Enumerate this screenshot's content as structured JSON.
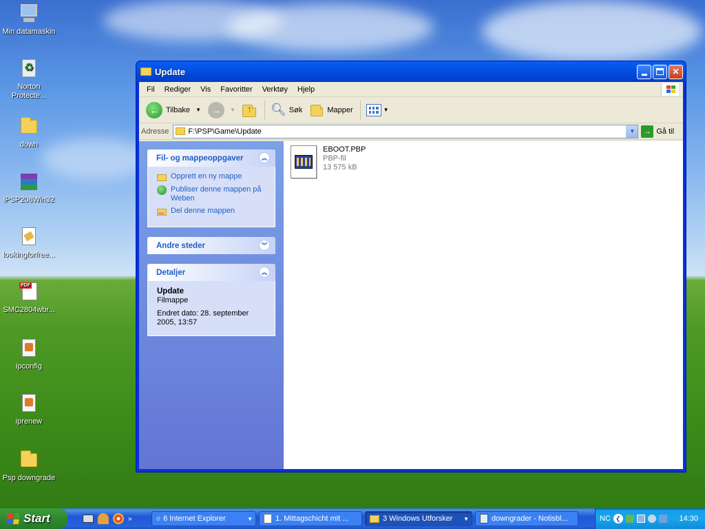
{
  "desktop": {
    "icons": [
      {
        "label": "Min datamaskin",
        "icon": "computer-icon"
      },
      {
        "label": "Norton Protecte...",
        "icon": "recycle-bin-icon"
      },
      {
        "label": "down",
        "icon": "folder-icon"
      },
      {
        "label": "iPSP208Win32",
        "icon": "winrar-archive-icon"
      },
      {
        "label": "lookingforfree...",
        "icon": "document-icon"
      },
      {
        "label": "SMC2804wbr...",
        "icon": "pdf-icon"
      },
      {
        "label": "ipconfig",
        "icon": "batch-file-icon"
      },
      {
        "label": "iprenew",
        "icon": "batch-file-icon"
      },
      {
        "label": "Psp downgrade",
        "icon": "folder-icon"
      }
    ]
  },
  "window": {
    "title": "Update",
    "menu": [
      "Fil",
      "Rediger",
      "Vis",
      "Favoritter",
      "Verktøy",
      "Hjelp"
    ],
    "toolbar": {
      "back": "Tilbake",
      "search": "Søk",
      "folders": "Mapper"
    },
    "address": {
      "label": "Adresse",
      "value": "F:\\PSP\\Game\\Update",
      "go": "Gå til"
    },
    "tasks": {
      "title": "Fil- og mappeoppgaver",
      "items": [
        "Opprett en ny mappe",
        "Publiser denne mappen på Weben",
        "Del denne mappen"
      ]
    },
    "other_places": {
      "title": "Andre steder"
    },
    "details": {
      "title": "Detaljer",
      "name": "Update",
      "type": "Filmappe",
      "modified": "Endret dato: 28. september 2005, 13:57"
    },
    "files": [
      {
        "name": "EBOOT.PBP",
        "type": "PBP-fil",
        "size": "13 575 kB"
      }
    ]
  },
  "taskbar": {
    "start": "Start",
    "buttons": [
      {
        "label": "6 Internet Explorer",
        "active": false
      },
      {
        "label": "1. Mittagschicht mit ...",
        "active": false
      },
      {
        "label": "3 Windows Utforsker",
        "active": true
      },
      {
        "label": "downgrader - Notisbl...",
        "active": false
      }
    ],
    "tray_text": "NC",
    "clock": "14:30"
  }
}
